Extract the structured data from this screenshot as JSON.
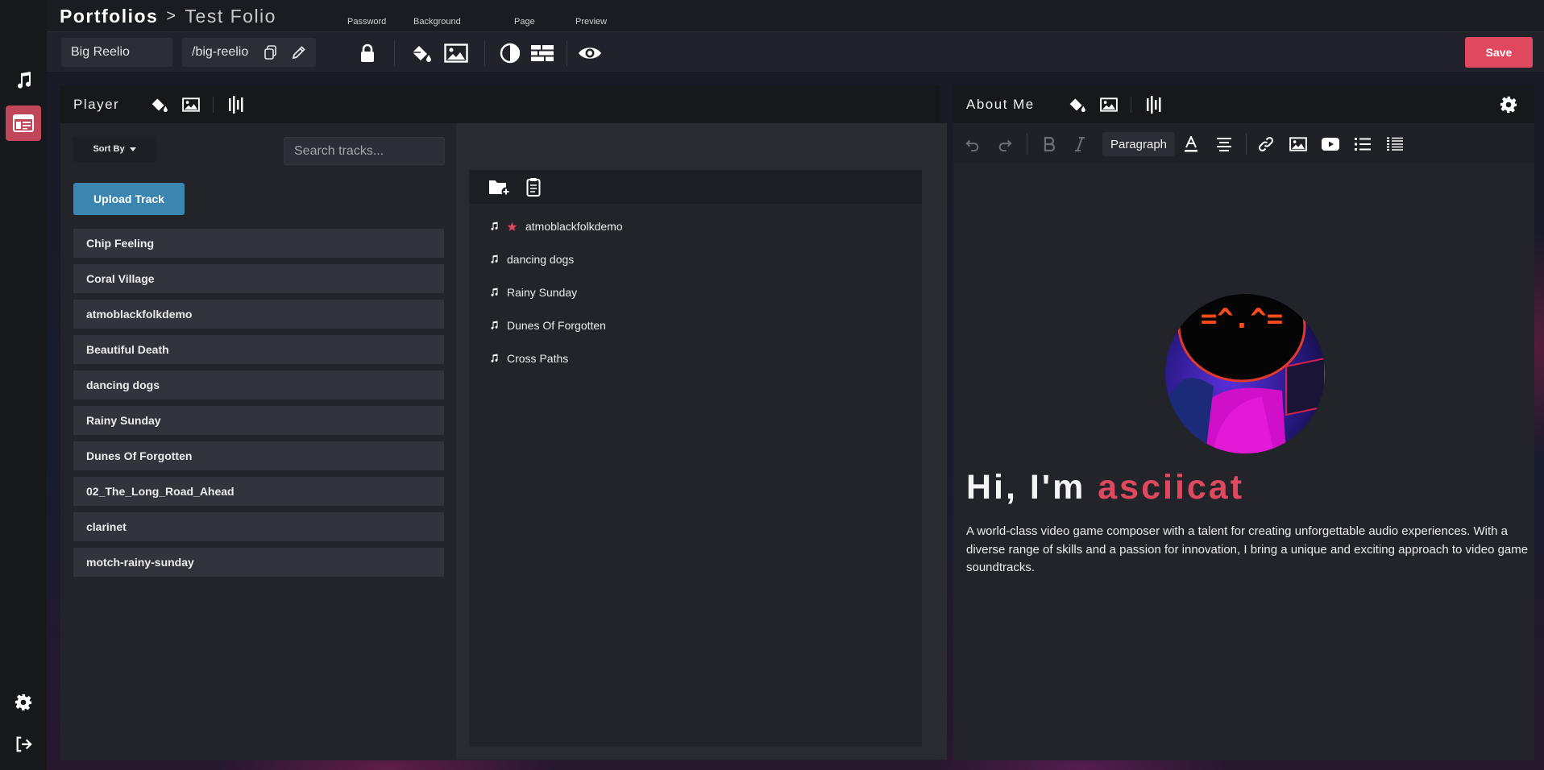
{
  "breadcrumb": {
    "root": "Portfolios",
    "separator": ">",
    "current": "Test Folio"
  },
  "toolbar": {
    "labels": {
      "password": "Password",
      "background": "Background",
      "page": "Page",
      "preview": "Preview"
    },
    "name_value": "Big Reelio",
    "slug_value": "/big-reelio",
    "save_label": "Save"
  },
  "sidebar": {
    "items": [
      {
        "icon": "music-note-icon"
      },
      {
        "icon": "portfolio-layout-icon",
        "active": true
      },
      {
        "icon": "gear-icon"
      },
      {
        "icon": "logout-icon"
      }
    ]
  },
  "player": {
    "title": "Player",
    "sort_label": "Sort By",
    "search_placeholder": "Search tracks...",
    "upload_label": "Upload Track",
    "tracks": [
      "Chip Feeling",
      "Coral Village",
      "atmoblackfolkdemo",
      "Beautiful Death",
      "dancing dogs",
      "Rainy Sunday",
      "Dunes Of Forgotten",
      "02_The_Long_Road_Ahead",
      "clarinet",
      "motch-rainy-sunday"
    ],
    "playlist": [
      {
        "name": "atmoblackfolkdemo",
        "starred": true
      },
      {
        "name": "dancing dogs",
        "starred": false
      },
      {
        "name": "Rainy Sunday",
        "starred": false
      },
      {
        "name": "Dunes Of Forgotten",
        "starred": false
      },
      {
        "name": "Cross Paths",
        "starred": false
      }
    ]
  },
  "about": {
    "title": "About Me",
    "paragraph_select": "Paragraph",
    "heading_prefix": "Hi, I'm ",
    "heading_name": "asciicat",
    "avatar_text": "=^.^=",
    "bio": "A world-class video game composer with a talent for creating unforgettable audio experiences. With a diverse range of skills and a passion for innovation, I bring a unique and exciting approach to video game soundtracks."
  },
  "colors": {
    "accent": "#e0485f",
    "upload_blue": "#3a86b0",
    "panel_bg": "#23242a",
    "header_bg": "#17181c"
  }
}
